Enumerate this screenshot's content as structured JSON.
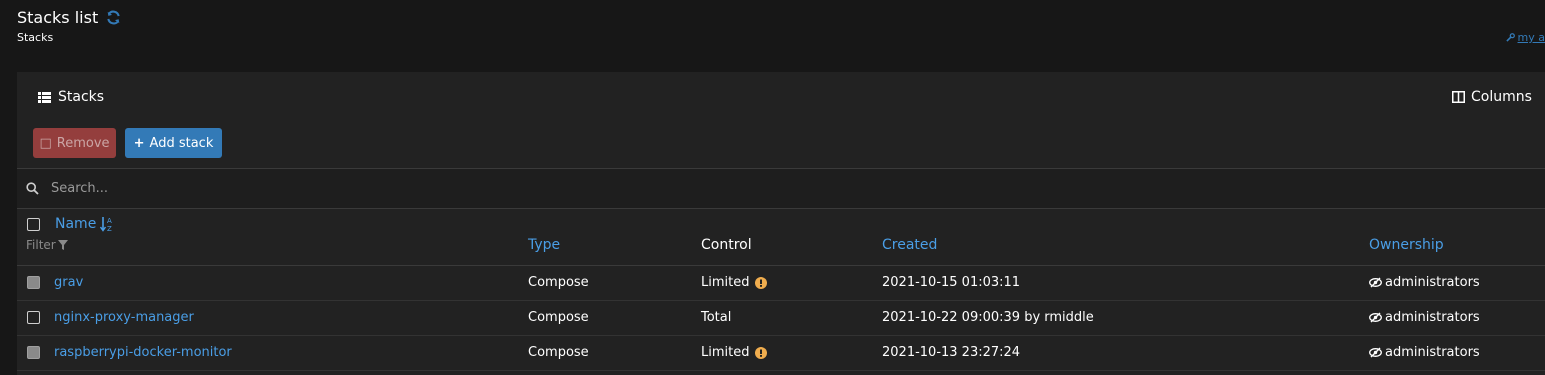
{
  "header": {
    "title": "Stacks list",
    "subtitle": "Stacks",
    "account_link": "my a"
  },
  "panel": {
    "heading": "Stacks",
    "columns_label": "Columns",
    "remove_label": "Remove",
    "add_label": "Add stack",
    "search_placeholder": "Search..."
  },
  "table": {
    "columns": {
      "name": "Name",
      "type": "Type",
      "control": "Control",
      "created": "Created",
      "ownership": "Ownership"
    },
    "filter_label": "Filter",
    "rows": [
      {
        "name": "grav",
        "type": "Compose",
        "control": "Limited",
        "warning": true,
        "created": "2021-10-15 01:03:11",
        "ownership": "administrators",
        "checkbox": "disabled"
      },
      {
        "name": "nginx-proxy-manager",
        "type": "Compose",
        "control": "Total",
        "warning": false,
        "created": "2021-10-22 09:00:39 by rmiddle",
        "ownership": "administrators",
        "checkbox": "enabled"
      },
      {
        "name": "raspberrypi-docker-monitor",
        "type": "Compose",
        "control": "Limited",
        "warning": true,
        "created": "2021-10-13 23:27:24",
        "ownership": "administrators",
        "checkbox": "disabled"
      }
    ]
  },
  "colors": {
    "accent": "#4a9ee6",
    "primary_button": "#337ab7",
    "danger_button": "#a94442",
    "warning": "#f0ad4e"
  }
}
